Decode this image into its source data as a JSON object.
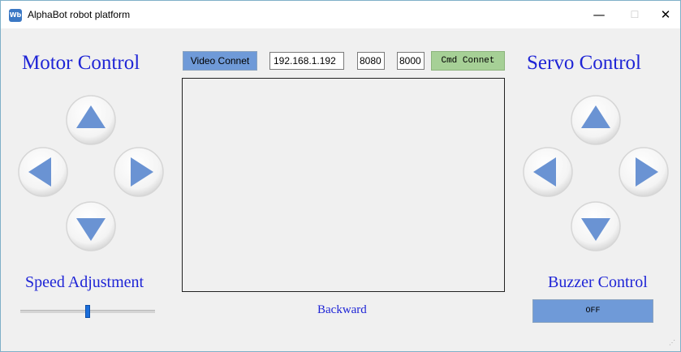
{
  "window": {
    "title": "AlphaBot robot platform",
    "app_icon_text": "Wb",
    "minimize_glyph": "—",
    "maximize_glyph": "☐",
    "close_glyph": "✕"
  },
  "motor": {
    "heading": "Motor Control",
    "up_icon": "arrow-up",
    "left_icon": "arrow-left",
    "right_icon": "arrow-right",
    "down_icon": "arrow-down"
  },
  "servo": {
    "heading": "Servo Control",
    "up_icon": "arrow-up",
    "left_icon": "arrow-left",
    "right_icon": "arrow-right",
    "down_icon": "arrow-down"
  },
  "connection": {
    "video_button": "Video Connet",
    "ip_address": "192.168.1.192",
    "video_port": "8080",
    "cmd_port": "8000",
    "cmd_button": "Cmd Connet"
  },
  "speed": {
    "heading": "Speed Adjustment",
    "value_fraction": 0.5
  },
  "status": {
    "text": "Backward"
  },
  "buzzer": {
    "heading": "Buzzer Control",
    "button_label": "OFF"
  },
  "colors": {
    "heading": "#1f25d6",
    "arrow_fill": "#6a93d3",
    "video_button": "#6f9ad8",
    "cmd_button": "#a6d096",
    "buzzer_button": "#6f9ad8"
  }
}
